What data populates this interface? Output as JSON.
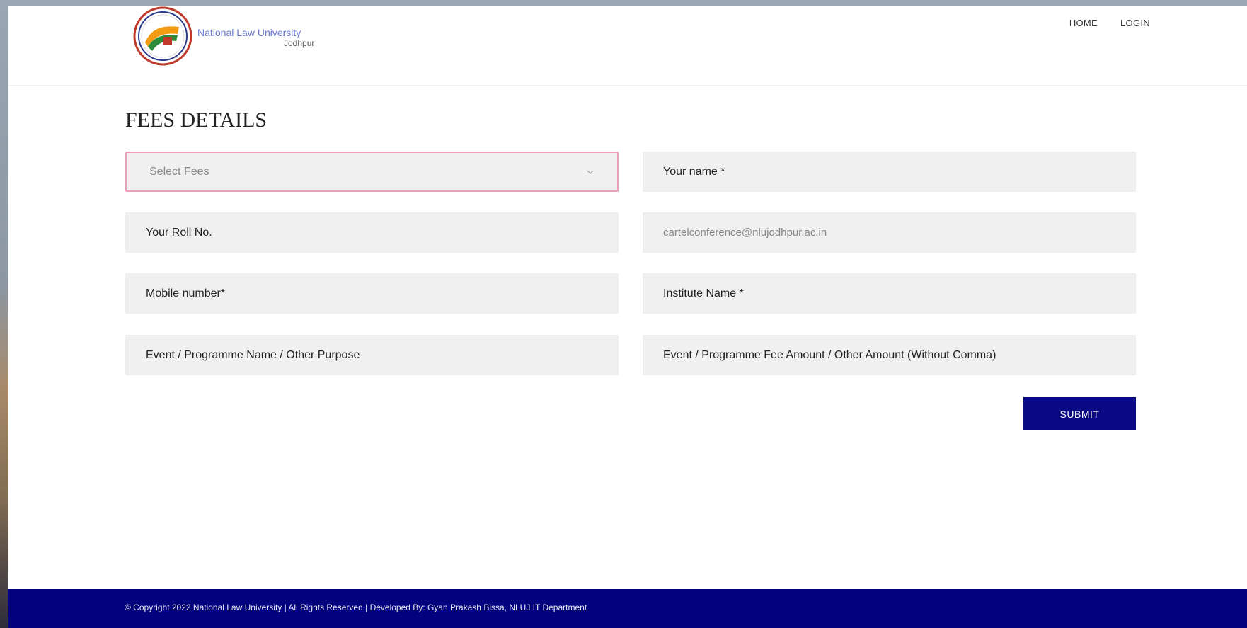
{
  "header": {
    "logo_title": "National Law University",
    "logo_subtitle": "Jodhpur",
    "nav": {
      "home": "HOME",
      "login": "LOGIN"
    }
  },
  "page_title": "FEES DETAILS",
  "form": {
    "select_fees": {
      "selected": "Select Fees"
    },
    "your_name": {
      "placeholder": "Your name *"
    },
    "roll_no": {
      "placeholder": "Your Roll No."
    },
    "email": {
      "placeholder": "cartelconference@nlujodhpur.ac.in"
    },
    "mobile": {
      "placeholder": "Mobile number*"
    },
    "institute": {
      "placeholder": "Institute Name *"
    },
    "event_name": {
      "placeholder": "Event / Programme Name / Other Purpose"
    },
    "event_amount": {
      "placeholder": "Event / Programme Fee Amount / Other Amount (Without Comma)"
    },
    "submit_label": "SUBMIT"
  },
  "footer": {
    "copyright": "© Copyright 2022 National Law University | All Rights Reserved.| Developed By: Gyan Prakash Bissa, NLUJ IT Department"
  },
  "colors": {
    "primary": "#02027e",
    "field_bg": "#f0f0f0",
    "select_border": "#e8a0b8"
  }
}
